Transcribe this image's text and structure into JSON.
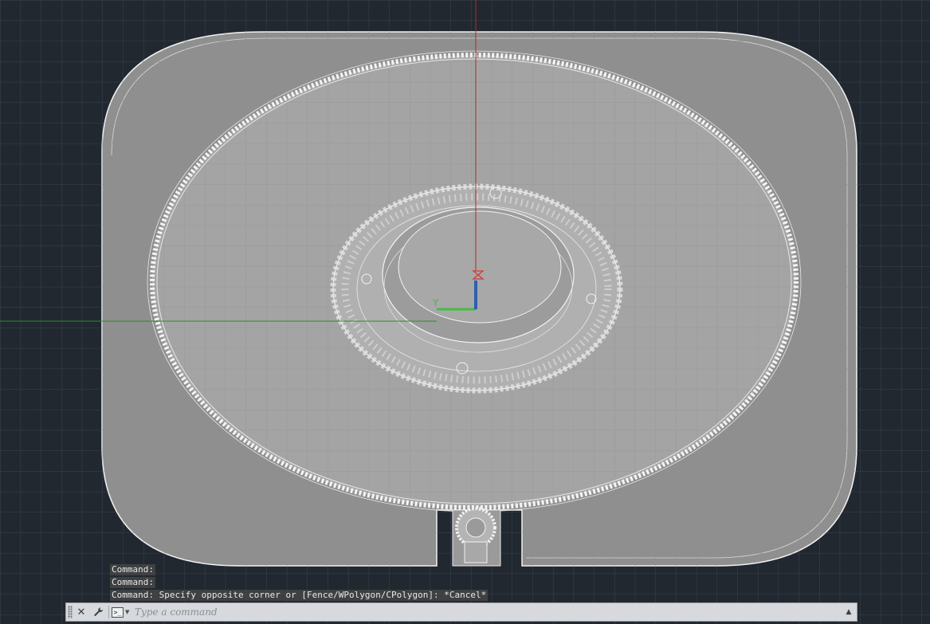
{
  "viewport": {
    "ucs_y_label": "Y",
    "colors": {
      "background": "#212830",
      "grid_major": "#3e4652",
      "part_fill": "#9a9a9a",
      "edge": "#f2f2f2",
      "x_axis": "#2f8a2f",
      "y_axis": "#b02a2a",
      "ucs_z": "#2f5fb0",
      "ucs_y": "#3fbf3f"
    }
  },
  "command_history": [
    "Command:",
    "Command:",
    "Command: Specify opposite corner or [Fence/WPolygon/CPolygon]: *Cancel*"
  ],
  "command_line": {
    "placeholder": "Type a command",
    "value": "",
    "prompt_glyph": ">_",
    "close_icon": "✕",
    "customize_icon": "wrench",
    "history_toggle_icon": "▲"
  }
}
